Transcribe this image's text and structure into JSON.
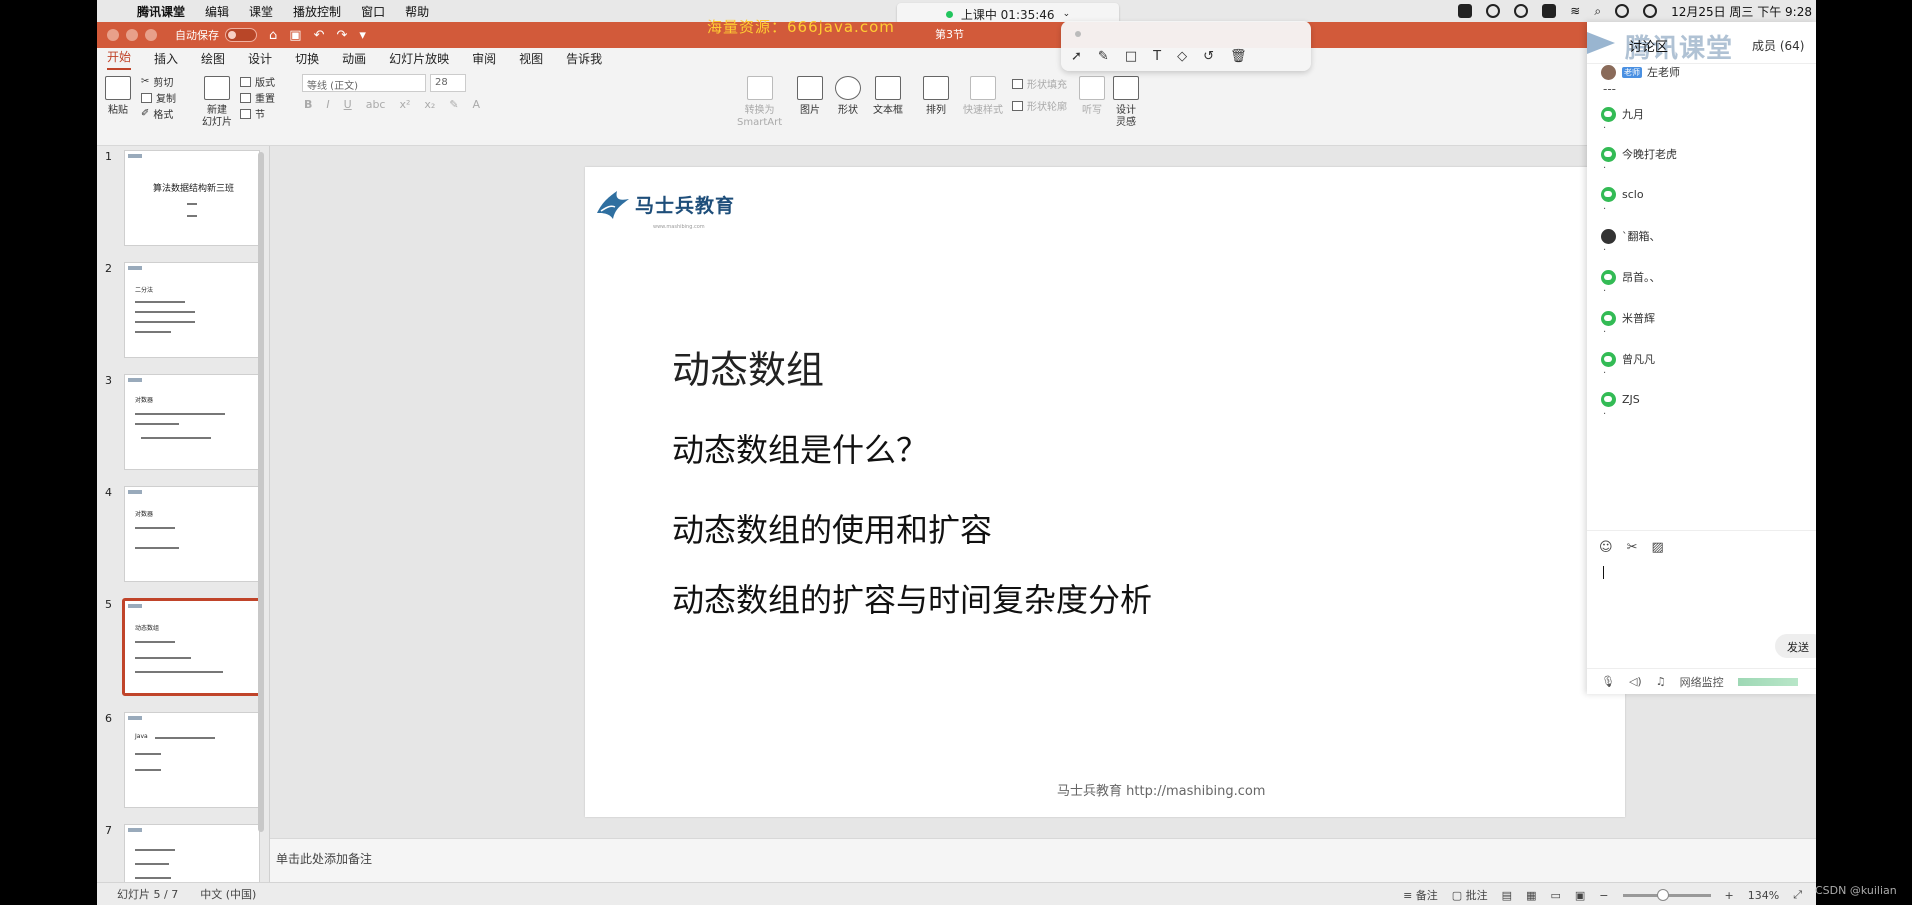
{
  "menubar": {
    "app": "腾讯课堂",
    "items": [
      "编辑",
      "课堂",
      "播放控制",
      "窗口",
      "帮助"
    ],
    "live_status": "上课中 01:35:46",
    "clock": "12月25日 周三 下午 9:28"
  },
  "watermark": "海量资源：666java.com",
  "titlebar": {
    "autosave_label": "自动保存",
    "doc_title": "第3节"
  },
  "ribbon_tabs": [
    "开始",
    "插入",
    "绘图",
    "设计",
    "切换",
    "动画",
    "幻灯片放映",
    "审阅",
    "视图",
    "告诉我"
  ],
  "ribbon": {
    "paste": "粘贴",
    "cut": "剪切",
    "copy": "复制",
    "format": "格式",
    "new_slide_1": "新建",
    "new_slide_2": "幻灯片",
    "layout": "版式",
    "reset": "重置",
    "section": "节",
    "font_name": "等线 (正文)",
    "font_size": "28",
    "smartart_1": "转换为",
    "smartart_2": "SmartArt",
    "picture": "图片",
    "shape": "形状",
    "textbox": "文本框",
    "arrange": "排列",
    "quick_styles": "快速样式",
    "shape_fill": "形状填充",
    "shape_outline": "形状轮廓",
    "dictate": "听写",
    "design_ideas_1": "设计",
    "design_ideas_2": "灵感"
  },
  "thumbnails": [
    {
      "num": "1",
      "title": "算法数据结构新三班"
    },
    {
      "num": "2",
      "title": "二分法"
    },
    {
      "num": "3",
      "title": "对数器"
    },
    {
      "num": "4",
      "title": "对数器"
    },
    {
      "num": "5",
      "title": "动态数组"
    },
    {
      "num": "6",
      "title": "Java"
    },
    {
      "num": "7",
      "title": ""
    }
  ],
  "slide": {
    "logo_text": "马士兵教育",
    "logo_sub": "www.mashibing.com",
    "heading": "动态数组",
    "bullets": [
      "动态数组是什么？",
      "动态数组的使用和扩容",
      "动态数组的扩容与时间复杂度分析"
    ],
    "footer": "马士兵教育 http://mashibing.com"
  },
  "notes_placeholder": "单击此处添加备注",
  "statusbar": {
    "slide_info": "幻灯片 5 / 7",
    "language": "中文 (中国)",
    "notes": "备注",
    "comments": "批注",
    "zoom": "134%",
    "zoom_fraction": 0.45
  },
  "chat": {
    "brand": "腾讯课堂",
    "title": "讨论区",
    "members": "成员 (64)",
    "teacher_tag": "老师",
    "messages": [
      {
        "name": "左老师",
        "text": "---",
        "avatar": "grey"
      },
      {
        "name": "九月",
        "text": ".",
        "avatar": "green"
      },
      {
        "name": "今晚打老虎",
        "text": ".",
        "avatar": "green"
      },
      {
        "name": "sclo",
        "text": ".",
        "avatar": "green"
      },
      {
        "name": "`翻箱、",
        "text": ".",
        "avatar": "dark"
      },
      {
        "name": "昂首。、",
        "text": ".",
        "avatar": "green"
      },
      {
        "name": "米普辉",
        "text": ".",
        "avatar": "green"
      },
      {
        "name": "曾凡凡",
        "text": ".",
        "avatar": "green"
      },
      {
        "name": "ZJS",
        "text": ".",
        "avatar": "green"
      }
    ],
    "send": "发送",
    "network": "网络监控"
  },
  "credit": "CSDN @kuilian"
}
